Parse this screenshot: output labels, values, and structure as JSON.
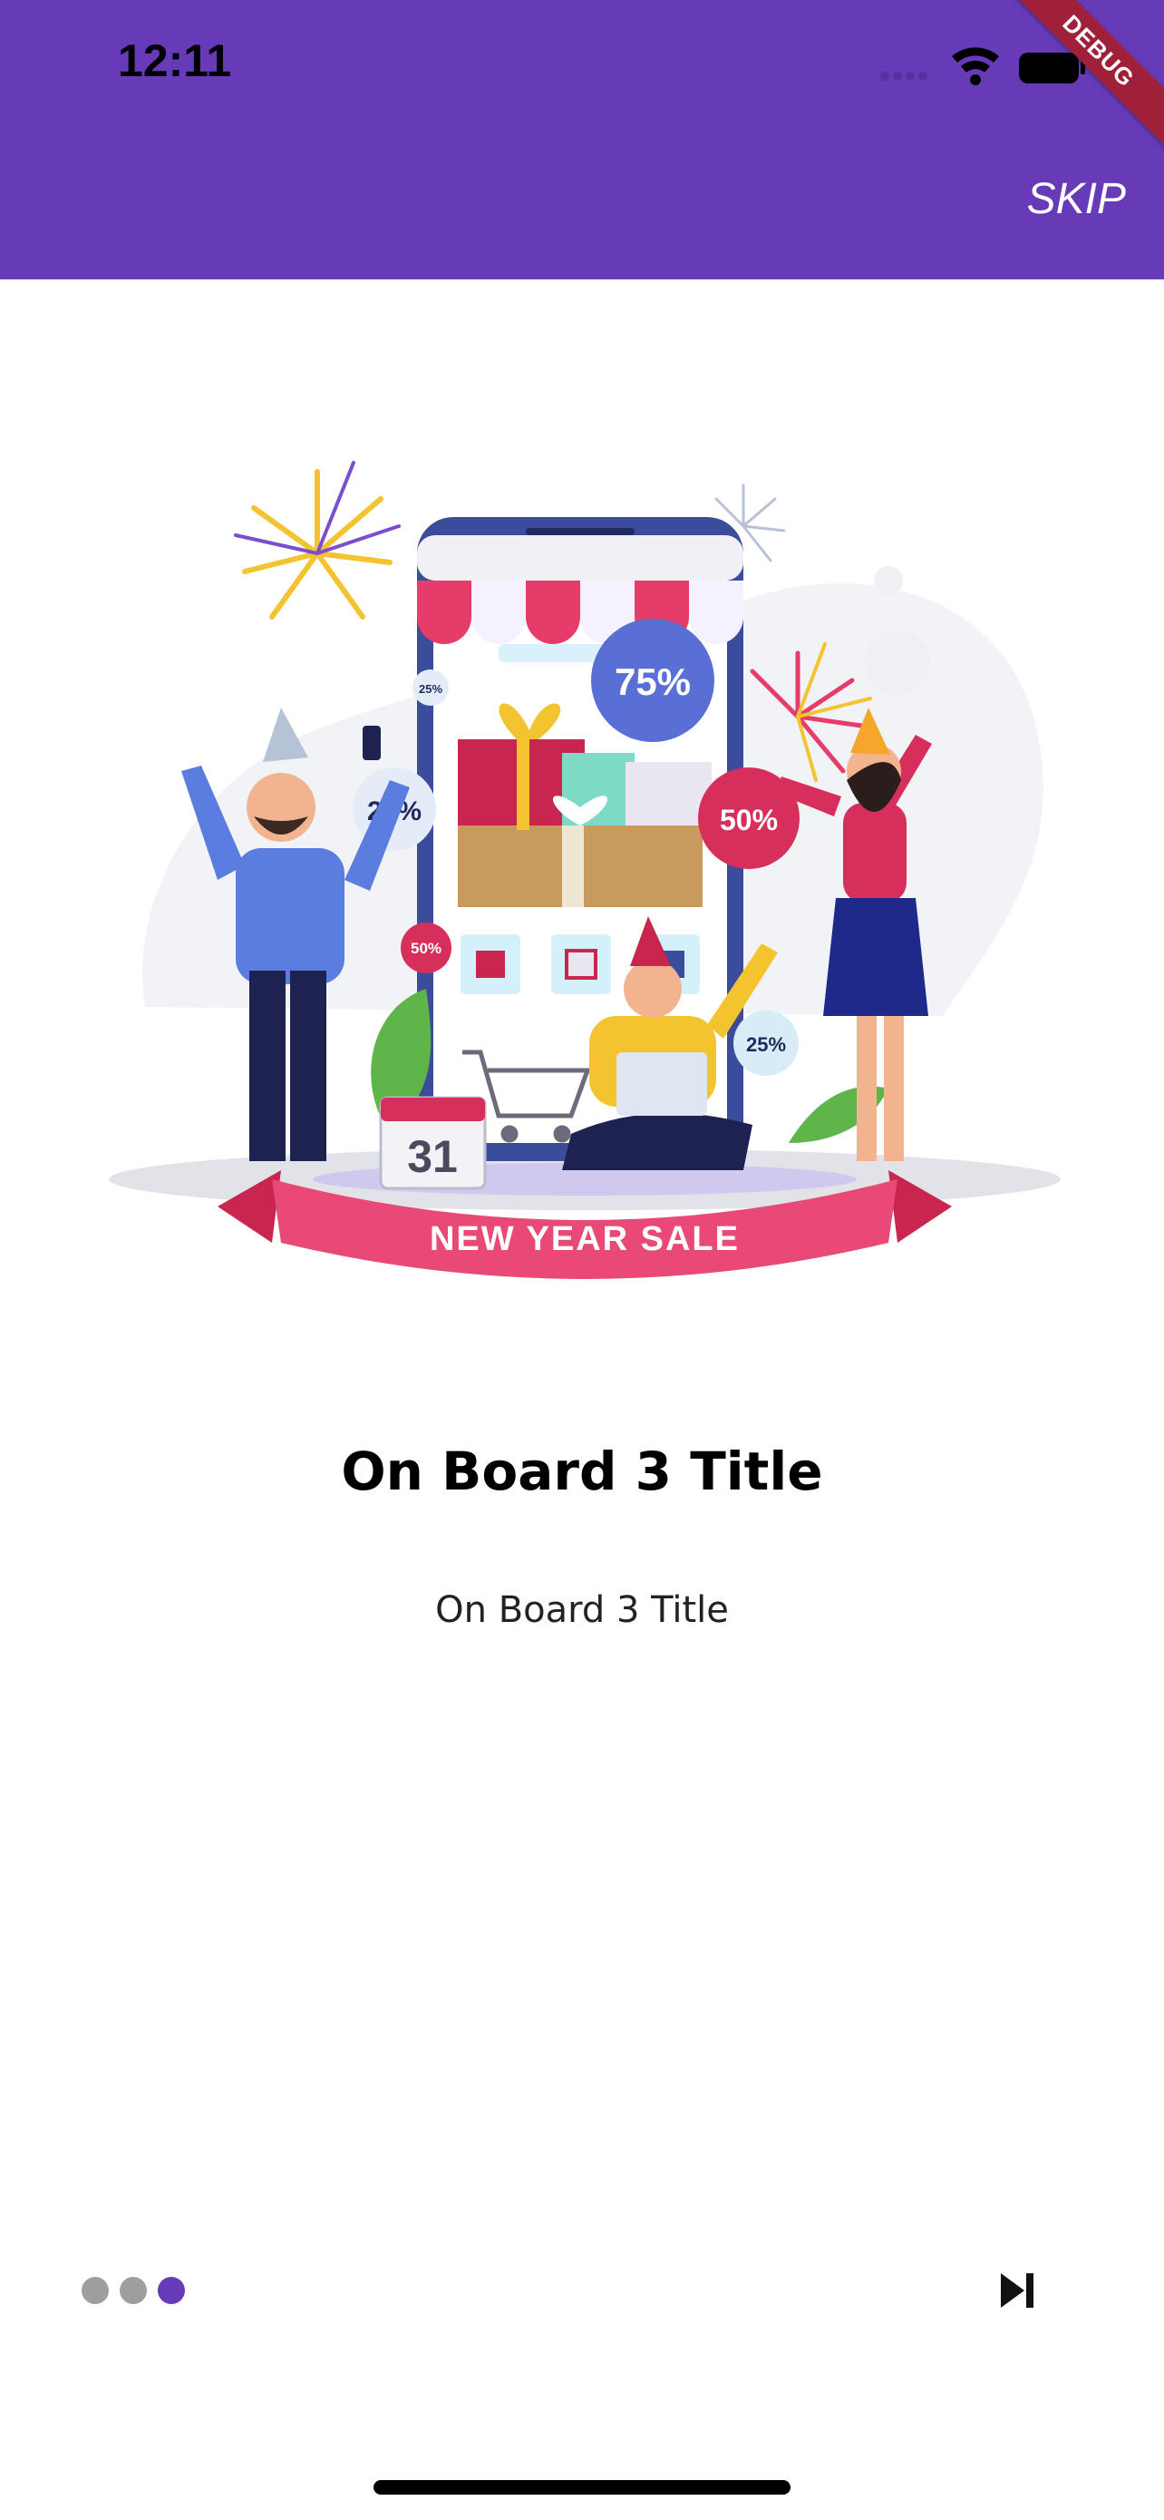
{
  "status_bar": {
    "time": "12:11"
  },
  "app_bar": {
    "skip_label": "SKIP",
    "background": "#673ab7"
  },
  "debug_banner": {
    "label": "DEBUG"
  },
  "illustration": {
    "discount_badges": [
      "75%",
      "25%",
      "50%",
      "25%",
      "50%",
      "25%"
    ],
    "calendar_day": "31",
    "ribbon_text": "NEW YEAR SALE"
  },
  "onboarding": {
    "title": "On Board 3 Title",
    "subtitle": "On Board 3 Title"
  },
  "pager": {
    "page_count": 3,
    "current_page": 3
  },
  "colors": {
    "accent": "#673ab7",
    "dot_inactive": "#9e9e9e"
  }
}
